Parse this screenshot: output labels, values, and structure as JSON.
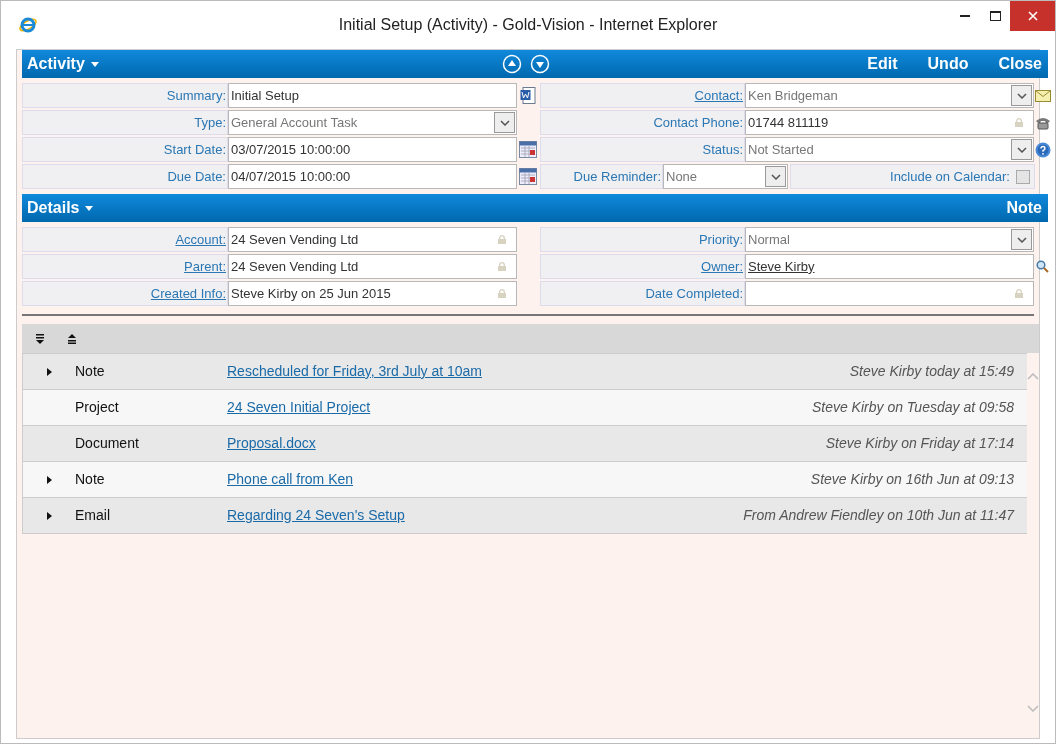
{
  "window": {
    "title": "Initial Setup (Activity) - Gold-Vision - Internet Explorer"
  },
  "activity_header": {
    "title": "Activity",
    "actions": [
      "Edit",
      "Undo",
      "Close"
    ]
  },
  "activity_left": [
    {
      "label": "Summary:",
      "link": false,
      "kind": "text",
      "value": "Initial Setup"
    },
    {
      "label": "Type:",
      "link": false,
      "kind": "select",
      "value": "General Account Task"
    },
    {
      "label": "Start Date:",
      "link": false,
      "kind": "date",
      "value": "03/07/2015 10:00:00"
    },
    {
      "label": "Due Date:",
      "link": false,
      "kind": "date",
      "value": "04/07/2015 10:00:00"
    }
  ],
  "activity_right": [
    {
      "label": "Contact:",
      "link": true,
      "kind": "select",
      "value": "Ken Bridgeman"
    },
    {
      "label": "Contact Phone:",
      "link": false,
      "kind": "locked",
      "value": "01744 811119"
    },
    {
      "label": "Status:",
      "link": false,
      "kind": "select",
      "value": "Not Started"
    },
    {
      "label": "Due Reminder:",
      "link": false,
      "kind": "reminder",
      "value": "None",
      "extra_label": "Include on Calendar:",
      "checked": false
    }
  ],
  "details_header": {
    "title": "Details",
    "actions": [
      "Note"
    ]
  },
  "details_left": [
    {
      "label": "Account:",
      "link": true,
      "kind": "locked",
      "value": "24 Seven Vending Ltd"
    },
    {
      "label": "Parent:",
      "link": true,
      "kind": "locked",
      "value": "24 Seven Vending Ltd"
    },
    {
      "label": "Created Info:",
      "link": true,
      "kind": "locked",
      "value": "Steve Kirby on 25 Jun 2015"
    }
  ],
  "details_right": [
    {
      "label": "Priority:",
      "link": false,
      "kind": "select",
      "value": "Normal"
    },
    {
      "label": "Owner:",
      "link": true,
      "kind": "lookup",
      "value": "Steve Kirby"
    },
    {
      "label": "Date Completed:",
      "link": false,
      "kind": "locked"
    }
  ],
  "timeline": [
    {
      "expandable": true,
      "type": "Note",
      "title": "Rescheduled for Friday, 3rd July at 10am",
      "meta": "Steve Kirby today at 15:49"
    },
    {
      "expandable": false,
      "type": "Project",
      "title": "24 Seven Initial Project",
      "meta": "Steve Kirby on Tuesday at 09:58"
    },
    {
      "expandable": false,
      "type": "Document",
      "title": "Proposal.docx",
      "meta": "Steve Kirby on Friday at 17:14"
    },
    {
      "expandable": true,
      "type": "Note",
      "title": "Phone call from Ken",
      "meta": "Steve Kirby on 16th Jun at 09:13"
    },
    {
      "expandable": true,
      "type": "Email",
      "title": "Regarding 24 Seven's Setup",
      "meta": "From Andrew Fiendley on 10th Jun at 11:47"
    }
  ]
}
